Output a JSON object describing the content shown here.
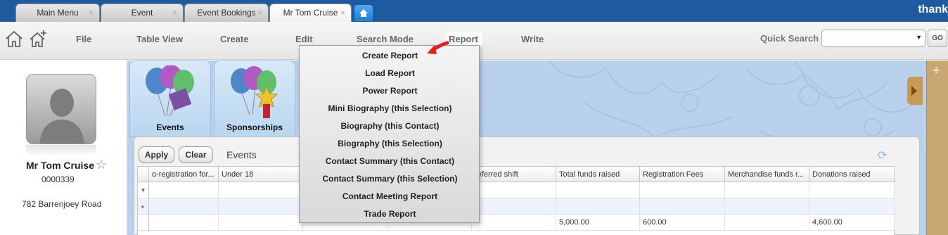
{
  "tabs": [
    {
      "label": "Main Menu",
      "close": "×"
    },
    {
      "label": "Event",
      "close": "×"
    },
    {
      "label": "Event Bookings",
      "close": "×"
    },
    {
      "label": "Mr Tom Cruise",
      "close": "×"
    }
  ],
  "brand": "thank",
  "menu": {
    "file": "File",
    "table_view": "Table View",
    "create": "Create",
    "edit": "Edit",
    "search_mode": "Search Mode",
    "report": "Report",
    "write": "Write"
  },
  "quick_search": {
    "label": "Quick Search",
    "value": "",
    "go": "GO"
  },
  "contact": {
    "name": "Mr Tom Cruise",
    "id": "0000339",
    "address": "782 Barrenjoey Road"
  },
  "modules": [
    {
      "label": "Events",
      "icon": "balloons-envelope-icon"
    },
    {
      "label": "Sponsorships",
      "icon": "balloons-medal-icon"
    }
  ],
  "panel": {
    "apply": "Apply",
    "clear": "Clear",
    "title": "Events"
  },
  "grid": {
    "columns": [
      "o-registration for...",
      "Under 18",
      "",
      "",
      "referred shift",
      "Total funds raised",
      "Registration Fees",
      "Merchandise funds r...",
      "Donations raised"
    ],
    "filter_marker": "▼",
    "row_marker": "▸",
    "total_row": [
      "",
      "",
      "",
      "",
      "",
      "5,000.00",
      "600.00",
      "",
      "4,600.00"
    ]
  },
  "report_menu": [
    "Create Report",
    "Load Report",
    "Power Report",
    "Mini Biography (this Selection)",
    "Biography (this Contact)",
    "Biography (this Selection)",
    "Contact Summary (this Contact)",
    "Contact Summary (this Selection)",
    "Contact Meeting Report",
    "Trade Report"
  ],
  "colors": {
    "tabbar": "#1e5a9e",
    "main_bg": "#b9d1ec",
    "arrow": "#e02020"
  }
}
